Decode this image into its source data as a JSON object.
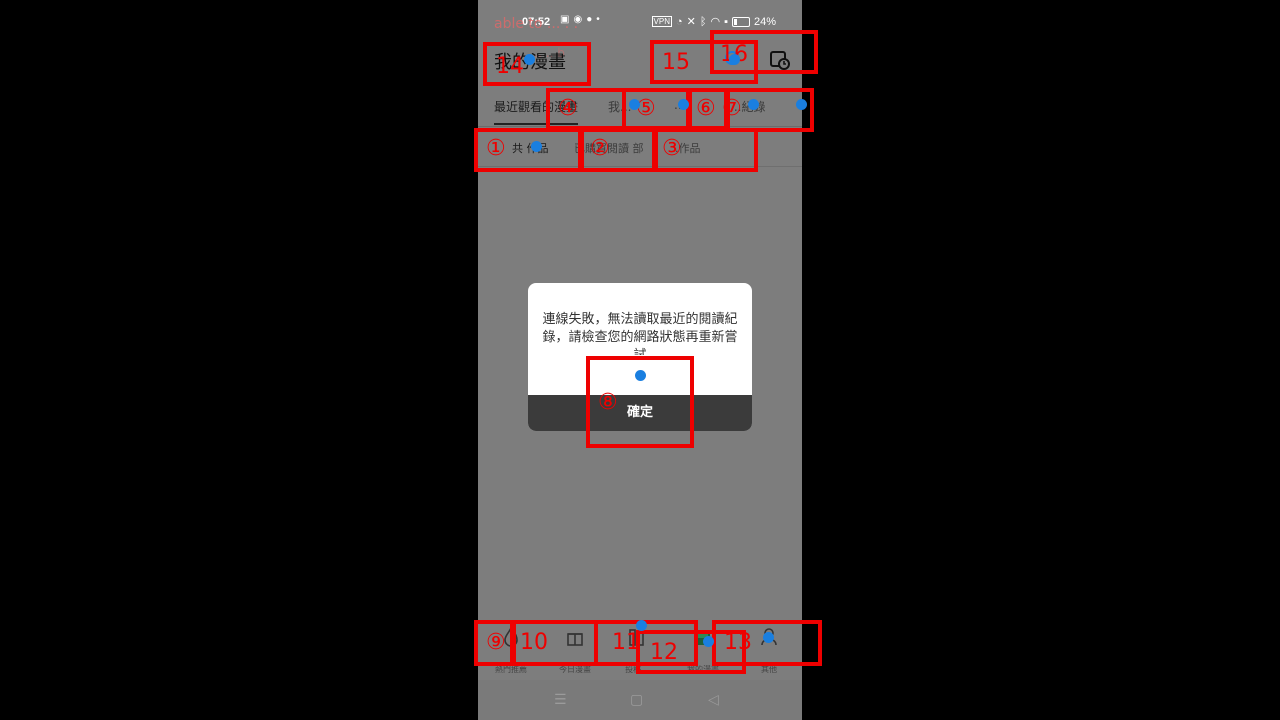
{
  "status_bar": {
    "time": "07:52",
    "vpn": "VPN",
    "battery": "24%"
  },
  "overlay": {
    "watermark_line1": "able to ... . .",
    "watermark_line2": "........ .. .. b"
  },
  "header": {
    "title": "我的漫畫"
  },
  "tabs": [
    {
      "label": "最近觀看的漫畫"
    },
    {
      "label": "我..."
    },
    {
      "label": "..."
    },
    {
      "label": "...紀錄"
    }
  ],
  "filters": [
    {
      "label": "共 作品"
    },
    {
      "label": "已購買閱讀 部"
    },
    {
      "label": "...作品"
    }
  ],
  "dialog": {
    "message": "連線失敗，無法讀取最近的閱讀紀錄，請檢查您的網路狀態再重新嘗試",
    "confirm_label": "確定"
  },
  "bottom_nav": [
    {
      "label": "熱門推薦",
      "icon": "flame-icon"
    },
    {
      "label": "今日漫畫",
      "icon": "gift-icon"
    },
    {
      "label": "投稿...",
      "icon": "bookshelf-icon"
    },
    {
      "label": "我的漫畫",
      "icon": "book-icon"
    },
    {
      "label": "其他",
      "icon": "person-icon"
    }
  ],
  "annotation_marks": [
    "①",
    "②",
    "③",
    "④",
    "⑤",
    "⑥",
    "⑦",
    "⑧",
    "⑨",
    "10",
    "11",
    "12",
    "13",
    "14",
    "15",
    "16"
  ],
  "colors": {
    "box_red": "#e00000",
    "dot_blue": "#1a7fe0",
    "dim_overlay": "#7d7d7d"
  }
}
